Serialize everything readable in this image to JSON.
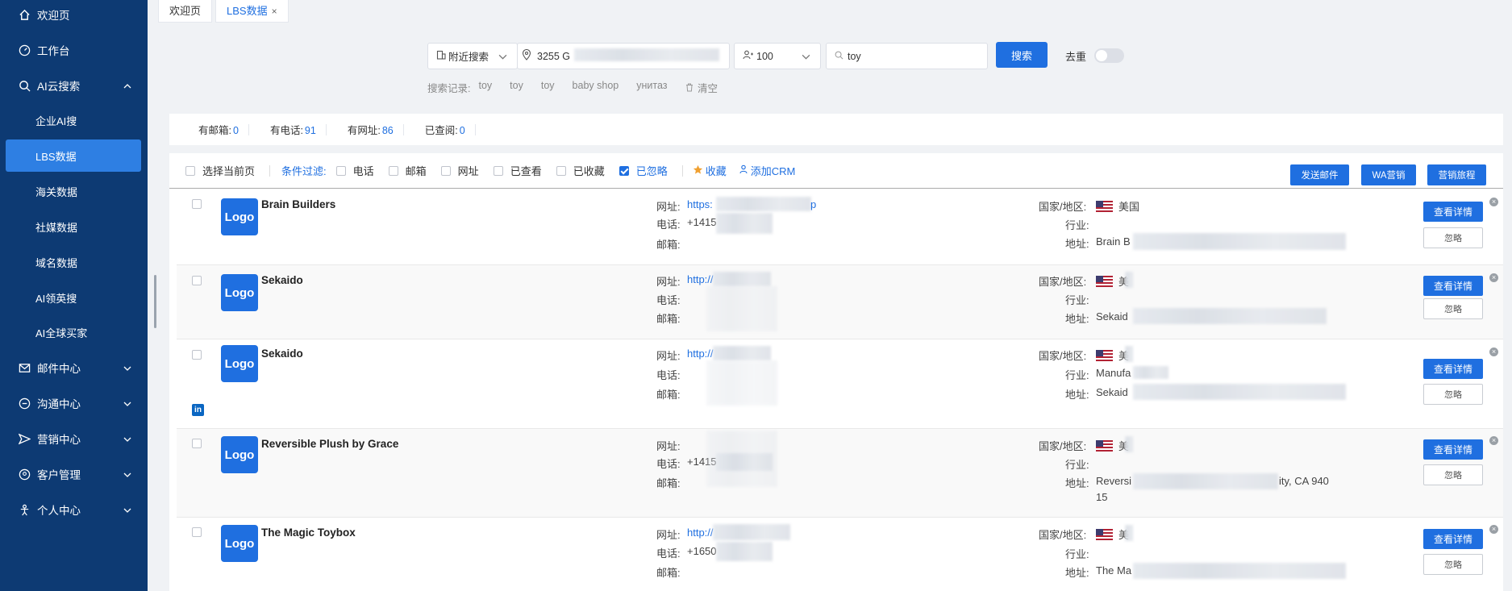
{
  "sidebar": {
    "items": [
      {
        "label": "欢迎页",
        "icon": "home-icon"
      },
      {
        "label": "工作台",
        "icon": "dashboard-icon"
      },
      {
        "label": "AI云搜索",
        "icon": "search-icon"
      },
      {
        "label": "邮件中心",
        "icon": "mail-icon"
      },
      {
        "label": "沟通中心",
        "icon": "chat-icon"
      },
      {
        "label": "营销中心",
        "icon": "send-icon"
      },
      {
        "label": "客户管理",
        "icon": "customer-icon"
      },
      {
        "label": "个人中心",
        "icon": "person-icon"
      }
    ],
    "sub_items": [
      "企业AI搜",
      "LBS数据",
      "海关数据",
      "社媒数据",
      "域名数据",
      "AI领英搜",
      "AI全球买家"
    ],
    "active_sub": "LBS数据"
  },
  "tabs": [
    {
      "label": "欢迎页",
      "active": false
    },
    {
      "label": "LBS数据",
      "active": true
    }
  ],
  "search": {
    "mode": "附近搜索",
    "location": "3255 G",
    "radius": "100",
    "keyword": "toy",
    "button": "搜索",
    "dedup_label": "去重",
    "dedup_on": false,
    "history_label": "搜索记录:",
    "history": [
      "toy",
      "toy",
      "toy",
      "baby shop",
      "унитаз"
    ],
    "clear_label": "清空"
  },
  "stats": [
    {
      "label": "有邮箱:",
      "value": "0"
    },
    {
      "label": "有电话:",
      "value": "91"
    },
    {
      "label": "有网址:",
      "value": "86"
    },
    {
      "label": "已查阅:",
      "value": "0"
    }
  ],
  "toolbar": {
    "select_page": "选择当前页",
    "filter_label": "条件过滤:",
    "filters": [
      {
        "label": "电话",
        "checked": false
      },
      {
        "label": "邮箱",
        "checked": false
      },
      {
        "label": "网址",
        "checked": false
      },
      {
        "label": "已查看",
        "checked": false
      },
      {
        "label": "已收藏",
        "checked": false
      },
      {
        "label": "已忽略",
        "checked": true
      }
    ],
    "favorite": "收藏",
    "add_crm": "添加CRM",
    "send_email": "发送邮件",
    "wa_marketing": "WA营销",
    "marketing_journey": "营销旅程"
  },
  "labels": {
    "website": "网址:",
    "phone": "电话:",
    "email": "邮箱:",
    "country": "国家/地区:",
    "industry": "行业:",
    "address": "地址:",
    "details": "查看详情",
    "ignore": "忽略",
    "logo": "Logo",
    "linkedin": "in"
  },
  "results": [
    {
      "name": "Brain Builders",
      "website": "https:",
      "website_tail": "p",
      "phone": "+1415",
      "email": "",
      "country": "美国",
      "industry": "",
      "address": "Brain B",
      "address_tail": "",
      "linkedin": false
    },
    {
      "name": "Sekaido",
      "website": "http://",
      "website_tail": "",
      "phone": "",
      "email": "",
      "country": "美",
      "industry": "",
      "address": "Sekaid",
      "address_tail": "",
      "linkedin": false
    },
    {
      "name": "Sekaido",
      "website": "http://",
      "website_tail": "",
      "phone": "",
      "email": "",
      "country": "美",
      "industry": "Manufa",
      "address": "Sekaid",
      "address_tail": "",
      "linkedin": true
    },
    {
      "name": "Reversible Plush by Grace",
      "website": "",
      "website_tail": "",
      "phone": "+1415",
      "email": "",
      "country": "美",
      "industry": "",
      "address": "Reversi",
      "address_tail": "ity, CA 940",
      "address_line2": "15",
      "linkedin": false
    },
    {
      "name": "The Magic Toybox",
      "website": "http://",
      "website_tail": "",
      "phone": "+1650",
      "email": "",
      "country": "美",
      "industry": "",
      "address": "The Ma",
      "address_tail": "",
      "linkedin": false
    }
  ],
  "colors": {
    "sidebar_bg": "#0d3a73",
    "accent": "#1f6fe0",
    "active_item": "#2e7fe3"
  }
}
